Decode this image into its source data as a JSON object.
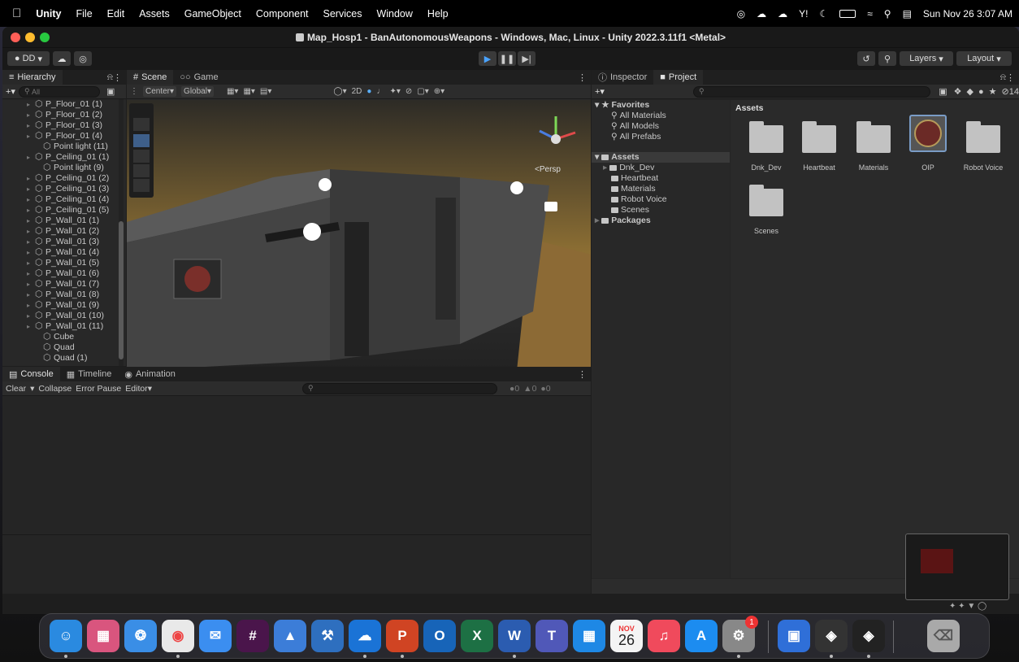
{
  "menubar": {
    "apple": "",
    "items": [
      "Unity",
      "File",
      "Edit",
      "Assets",
      "GameObject",
      "Component",
      "Services",
      "Window",
      "Help"
    ],
    "clock": "Sun Nov 26 3:07 AM"
  },
  "window": {
    "title": "Map_Hosp1 - BanAutonomousWeapons - Windows, Mac, Linux - Unity 2022.3.11f1 <Metal>"
  },
  "toolbar": {
    "account": "DD",
    "layers": "Layers",
    "layout": "Layout"
  },
  "hierarchy": {
    "tab": "Hierarchy",
    "search_placeholder": "All",
    "items": [
      "P_Floor_01 (1)",
      "P_Floor_01 (2)",
      "P_Floor_01 (3)",
      "P_Floor_01 (4)",
      "Point light (11)",
      "P_Ceiling_01 (1)",
      "Point light (9)",
      "P_Ceiling_01 (2)",
      "P_Ceiling_01 (3)",
      "P_Ceiling_01 (4)",
      "P_Ceiling_01 (5)",
      "P_Wall_01 (1)",
      "P_Wall_01 (2)",
      "P_Wall_01 (3)",
      "P_Wall_01 (4)",
      "P_Wall_01 (5)",
      "P_Wall_01 (6)",
      "P_Wall_01 (7)",
      "P_Wall_01 (8)",
      "P_Wall_01 (9)",
      "P_Wall_01 (10)",
      "P_Wall_01 (11)",
      "Cube",
      "Quad",
      "Quad (1)"
    ]
  },
  "scene": {
    "tabs": [
      "Scene",
      "Game"
    ],
    "pivot": "Center",
    "space": "Global",
    "mode2d": "2D",
    "persp": "<Persp"
  },
  "inspector": {
    "tabs": [
      "Inspector",
      "Project"
    ],
    "favorites_label": "Favorites",
    "favorites": [
      "All Materials",
      "All Models",
      "All Prefabs"
    ],
    "assets_label": "Assets",
    "asset_tree": [
      "Dnk_Dev",
      "Heartbeat",
      "Materials",
      "Robot Voice",
      "Scenes"
    ],
    "packages_label": "Packages",
    "grid_header": "Assets",
    "grid_items": [
      "Dnk_Dev",
      "Heartbeat",
      "Materials",
      "OIP",
      "Robot Voice",
      "Scenes"
    ],
    "hidden_count": "14"
  },
  "console": {
    "tabs": [
      "Console",
      "Timeline",
      "Animation"
    ],
    "buttons": [
      "Clear",
      "Collapse",
      "Error Pause",
      "Editor"
    ],
    "counts": [
      "0",
      "0",
      "0"
    ]
  },
  "dock": {
    "calendar_month": "NOV",
    "calendar_day": "26",
    "badge": "1"
  }
}
